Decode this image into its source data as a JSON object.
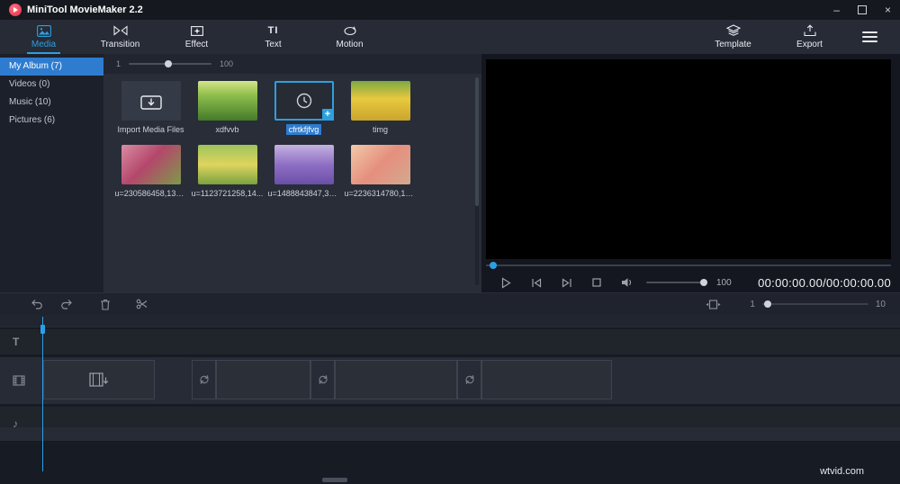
{
  "titlebar": {
    "title": "MiniTool MovieMaker 2.2"
  },
  "toolbar": {
    "tabs": [
      {
        "label": "Media"
      },
      {
        "label": "Transition"
      },
      {
        "label": "Effect"
      },
      {
        "label": "Text"
      },
      {
        "label": "Motion"
      }
    ],
    "template_label": "Template",
    "export_label": "Export"
  },
  "sidebar": {
    "items": [
      {
        "label": "My Album (7)"
      },
      {
        "label": "Videos (0)"
      },
      {
        "label": "Music (10)"
      },
      {
        "label": "Pictures (6)"
      }
    ]
  },
  "library": {
    "zoom_min": "1",
    "zoom_max": "100",
    "items": [
      {
        "label": "Import Media Files"
      },
      {
        "label": "xdfvvb"
      },
      {
        "label": "cfrtkfjfvg"
      },
      {
        "label": "timg"
      },
      {
        "label": "u=230586458,131..."
      },
      {
        "label": "u=1123721258,14..."
      },
      {
        "label": "u=1488843847,36..."
      },
      {
        "label": "u=2236314780,14..."
      }
    ]
  },
  "preview": {
    "volume": "100",
    "timecode": "00:00:00.00/00:00:00.00"
  },
  "editbar": {
    "zoom_min": "1",
    "zoom_max": "10"
  },
  "icons": {
    "minimize": "–",
    "close": "×",
    "plus": "+",
    "text_tool": "TI",
    "text_track": "T",
    "music_note": "♪"
  },
  "watermark": "wtvid.com",
  "colors": {
    "accent": "#2d9fe0",
    "selection": "#2e7cd0"
  }
}
